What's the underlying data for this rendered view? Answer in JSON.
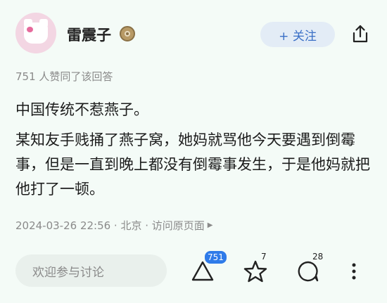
{
  "author": {
    "name": "雷震子",
    "avatar_icon": "avatar-image",
    "badge_icon": "medal-badge-icon"
  },
  "header": {
    "follow_label": "+ 关注",
    "share_icon": "share-icon"
  },
  "answer": {
    "likes_text": "751 人赞同了该回答",
    "paragraph1": "中国传统不惹燕子。",
    "paragraph2": "某知友手贱捅了燕子窝，她妈就骂他今天要遇到倒霉事，但是一直到晚上都没有倒霉事发生，于是他妈就把他打了一顿。",
    "meta": "2024-03-26 22:56 · 北京 · 访问原页面"
  },
  "footer": {
    "comment_placeholder": "欢迎参与讨论",
    "upvote_count": "751",
    "favorite_count": "7",
    "comment_count": "28"
  },
  "colors": {
    "background": "#f4fbf7",
    "accent": "#2f7be9",
    "follow_text": "#3a6fc6"
  }
}
